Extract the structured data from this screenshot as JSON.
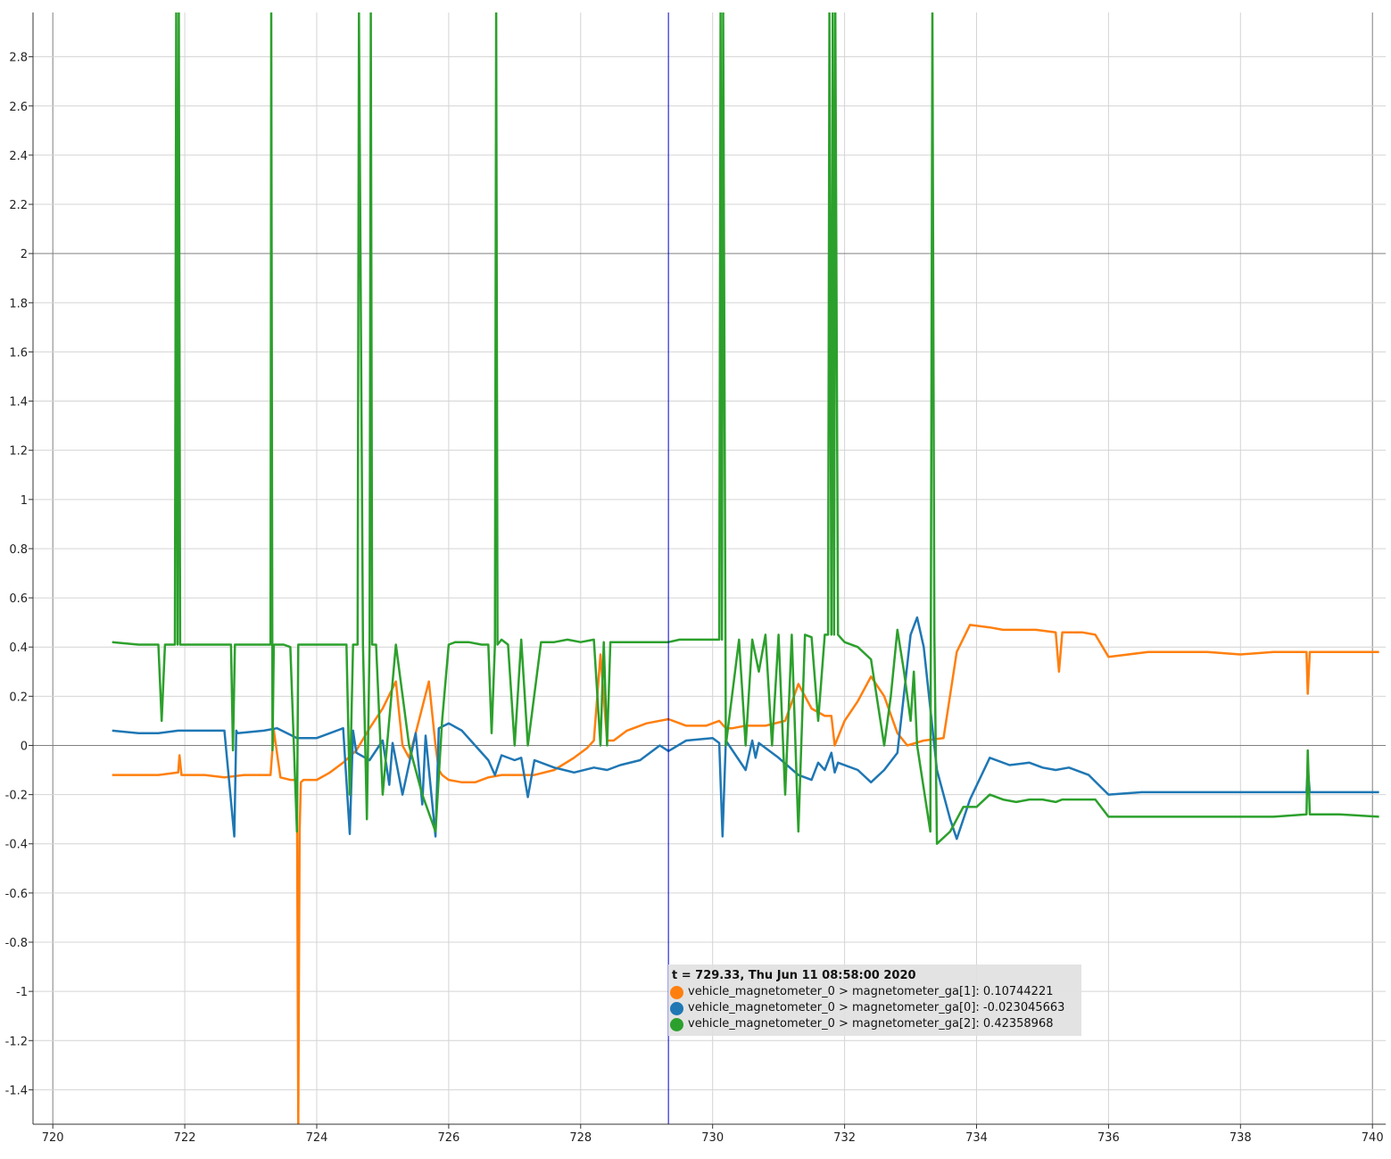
{
  "chart_data": {
    "type": "line",
    "xlim": [
      719.7,
      740.2
    ],
    "ylim": [
      -1.54,
      2.98
    ],
    "x_ticks": [
      720,
      722,
      724,
      726,
      728,
      730,
      732,
      734,
      736,
      738,
      740
    ],
    "y_ticks": [
      2.8,
      2.6,
      2.4,
      2.2,
      2,
      1.8,
      1.6,
      1.4,
      1.2,
      1,
      0.8,
      0.6,
      0.4,
      0.2,
      0,
      -0.2,
      -0.4,
      -0.6,
      -0.8,
      -1,
      -1.2,
      -1.4
    ],
    "x_tick_labels": [
      "720",
      "722",
      "724",
      "726",
      "728",
      "730",
      "732",
      "734",
      "736",
      "738",
      "740"
    ],
    "y_tick_labels": [
      "2.8",
      "2.6",
      "2.4",
      "2.2",
      "2",
      "1.8",
      "1.6",
      "1.4",
      "1.2",
      "1",
      "0.8",
      "0.6",
      "0.4",
      "0.2",
      "0",
      "-0.2",
      "-0.4",
      "-0.6",
      "-0.8",
      "-1",
      "-1.2",
      "-1.4"
    ],
    "grid": true,
    "cursor_x": 729.33,
    "series": [
      {
        "name": "vehicle_magnetometer_0 > magnetometer_ga[1]",
        "color": "#ff7f0e",
        "x": [
          720.9,
          721.3,
          721.6,
          721.9,
          721.92,
          721.95,
          722.3,
          722.6,
          722.9,
          723.2,
          723.3,
          723.35,
          723.45,
          723.6,
          723.7,
          723.72,
          723.74,
          723.76,
          723.8,
          724.0,
          724.2,
          724.4,
          724.6,
          724.8,
          725.0,
          725.2,
          725.3,
          725.4,
          725.5,
          725.7,
          725.8,
          725.85,
          725.9,
          726.0,
          726.2,
          726.4,
          726.6,
          726.8,
          727.0,
          727.3,
          727.6,
          727.9,
          728.1,
          728.2,
          728.3,
          728.4,
          728.5,
          728.7,
          729.0,
          729.33,
          729.6,
          729.9,
          730.1,
          730.2,
          730.3,
          730.5,
          730.8,
          731.1,
          731.3,
          731.5,
          731.7,
          731.8,
          731.85,
          732.0,
          732.2,
          732.4,
          732.6,
          732.8,
          732.95,
          733.2,
          733.5,
          733.7,
          733.9,
          734.2,
          734.4,
          734.6,
          734.9,
          735.2,
          735.25,
          735.3,
          735.6,
          735.8,
          736.0,
          736.3,
          736.6,
          737.0,
          737.5,
          738.0,
          738.5,
          739.0,
          739.02,
          739.05,
          739.5,
          740.1
        ],
        "values": [
          -0.12,
          -0.12,
          -0.12,
          -0.11,
          -0.04,
          -0.12,
          -0.12,
          -0.13,
          -0.12,
          -0.12,
          -0.12,
          0.06,
          -0.13,
          -0.14,
          -0.14,
          -1.54,
          -0.35,
          -0.15,
          -0.14,
          -0.14,
          -0.11,
          -0.07,
          -0.02,
          0.07,
          0.15,
          0.26,
          0.0,
          -0.05,
          0.05,
          0.26,
          0.0,
          -0.1,
          -0.12,
          -0.14,
          -0.15,
          -0.15,
          -0.13,
          -0.12,
          -0.12,
          -0.12,
          -0.1,
          -0.05,
          -0.01,
          0.02,
          0.37,
          0.02,
          0.02,
          0.06,
          0.09,
          0.107,
          0.08,
          0.08,
          0.1,
          0.07,
          0.07,
          0.08,
          0.08,
          0.1,
          0.25,
          0.15,
          0.12,
          0.12,
          0.0,
          0.1,
          0.18,
          0.28,
          0.2,
          0.05,
          0.0,
          0.02,
          0.03,
          0.38,
          0.49,
          0.48,
          0.47,
          0.47,
          0.47,
          0.46,
          0.3,
          0.46,
          0.46,
          0.45,
          0.36,
          0.37,
          0.38,
          0.38,
          0.38,
          0.37,
          0.38,
          0.38,
          0.21,
          0.38,
          0.38,
          0.38
        ]
      },
      {
        "name": "vehicle_magnetometer_0 > magnetometer_ga[0]",
        "color": "#1f77b4",
        "x": [
          720.9,
          721.3,
          721.6,
          721.9,
          722.2,
          722.6,
          722.75,
          722.78,
          722.8,
          723.2,
          723.4,
          723.7,
          724.0,
          724.4,
          724.5,
          724.55,
          724.6,
          724.8,
          725.0,
          725.1,
          725.15,
          725.3,
          725.5,
          725.6,
          725.65,
          725.8,
          725.85,
          726.0,
          726.2,
          726.4,
          726.6,
          726.7,
          726.8,
          727.0,
          727.1,
          727.2,
          727.3,
          727.6,
          727.9,
          728.2,
          728.4,
          728.6,
          728.9,
          729.2,
          729.33,
          729.6,
          730.0,
          730.1,
          730.15,
          730.2,
          730.5,
          730.6,
          730.65,
          730.7,
          731.0,
          731.3,
          731.5,
          731.6,
          731.7,
          731.8,
          731.85,
          731.9,
          732.2,
          732.4,
          732.6,
          732.8,
          733.0,
          733.1,
          733.2,
          733.4,
          733.6,
          733.7,
          733.9,
          734.2,
          734.5,
          734.8,
          735.0,
          735.2,
          735.4,
          735.7,
          736.0,
          736.5,
          737.0,
          737.5,
          738.0,
          738.5,
          739.0,
          739.02,
          739.05,
          739.5,
          740.1
        ],
        "values": [
          0.06,
          0.05,
          0.05,
          0.06,
          0.06,
          0.06,
          -0.37,
          0.06,
          0.05,
          0.06,
          0.07,
          0.03,
          0.03,
          0.07,
          -0.36,
          0.06,
          -0.03,
          -0.06,
          0.02,
          -0.16,
          0.01,
          -0.2,
          0.05,
          -0.24,
          0.04,
          -0.37,
          0.07,
          0.09,
          0.06,
          0.0,
          -0.06,
          -0.12,
          -0.04,
          -0.06,
          -0.05,
          -0.21,
          -0.06,
          -0.09,
          -0.11,
          -0.09,
          -0.1,
          -0.08,
          -0.06,
          0.0,
          -0.023,
          0.02,
          0.03,
          0.01,
          -0.37,
          0.02,
          -0.1,
          0.02,
          -0.05,
          0.01,
          -0.05,
          -0.12,
          -0.14,
          -0.07,
          -0.1,
          -0.03,
          -0.11,
          -0.07,
          -0.1,
          -0.15,
          -0.1,
          -0.03,
          0.45,
          0.52,
          0.4,
          -0.1,
          -0.3,
          -0.38,
          -0.22,
          -0.05,
          -0.08,
          -0.07,
          -0.09,
          -0.1,
          -0.09,
          -0.12,
          -0.2,
          -0.19,
          -0.19,
          -0.19,
          -0.19,
          -0.19,
          -0.19,
          -0.09,
          -0.19,
          -0.19,
          -0.19
        ]
      },
      {
        "name": "vehicle_magnetometer_0 > magnetometer_ga[2]",
        "color": "#2ca02c",
        "x": [
          720.9,
          721.3,
          721.6,
          721.65,
          721.7,
          721.85,
          721.87,
          721.89,
          721.91,
          721.93,
          721.96,
          722.3,
          722.6,
          722.7,
          722.73,
          722.76,
          722.8,
          723.2,
          723.3,
          723.31,
          723.33,
          723.35,
          723.5,
          723.6,
          723.7,
          723.72,
          723.74,
          724.0,
          724.2,
          724.45,
          724.5,
          724.55,
          724.62,
          724.64,
          724.7,
          724.76,
          724.8,
          724.82,
          724.84,
          724.9,
          725.0,
          725.2,
          725.4,
          725.6,
          725.8,
          725.9,
          726.0,
          726.1,
          726.3,
          726.5,
          726.6,
          726.65,
          726.7,
          726.72,
          726.74,
          726.8,
          726.9,
          727.0,
          727.1,
          727.2,
          727.4,
          727.6,
          727.8,
          728.0,
          728.2,
          728.3,
          728.35,
          728.4,
          728.45,
          728.6,
          728.65,
          728.9,
          729.0,
          729.33,
          729.5,
          729.8,
          730.0,
          730.1,
          730.12,
          730.14,
          730.16,
          730.2,
          730.4,
          730.5,
          730.6,
          730.7,
          730.8,
          730.9,
          731.0,
          731.1,
          731.2,
          731.3,
          731.4,
          731.5,
          731.6,
          731.7,
          731.75,
          731.77,
          731.8,
          731.82,
          731.84,
          731.86,
          731.9,
          732.0,
          732.2,
          732.4,
          732.6,
          732.7,
          732.8,
          732.9,
          733.0,
          733.05,
          733.1,
          733.3,
          733.33,
          733.36,
          733.4,
          733.6,
          733.8,
          734.0,
          734.2,
          734.4,
          734.6,
          734.8,
          735.0,
          735.2,
          735.3,
          735.6,
          735.8,
          736.0,
          736.5,
          737.0,
          737.5,
          738.0,
          738.5,
          739.0,
          739.02,
          739.05,
          739.5,
          740.1
        ],
        "values": [
          0.42,
          0.41,
          0.41,
          0.1,
          0.41,
          0.41,
          2.98,
          0.41,
          2.98,
          0.41,
          0.41,
          0.41,
          0.41,
          0.41,
          -0.02,
          0.41,
          0.41,
          0.41,
          0.41,
          2.98,
          -0.02,
          0.41,
          0.41,
          0.4,
          -0.35,
          0.41,
          0.41,
          0.41,
          0.41,
          0.41,
          -0.2,
          0.41,
          0.41,
          2.98,
          0.41,
          -0.3,
          0.41,
          2.98,
          0.41,
          0.41,
          -0.2,
          0.41,
          0.0,
          -0.2,
          -0.35,
          0.1,
          0.41,
          0.42,
          0.42,
          0.41,
          0.41,
          0.05,
          0.41,
          2.98,
          0.41,
          0.43,
          0.41,
          0.0,
          0.43,
          0.0,
          0.42,
          0.42,
          0.43,
          0.42,
          0.43,
          0.0,
          0.42,
          0.0,
          0.42,
          0.42,
          0.42,
          0.42,
          0.42,
          0.42,
          0.43,
          0.43,
          0.43,
          0.43,
          2.98,
          0.43,
          2.98,
          0.0,
          0.43,
          0.0,
          0.43,
          0.3,
          0.45,
          0.0,
          0.45,
          -0.2,
          0.45,
          -0.35,
          0.45,
          0.44,
          0.1,
          0.45,
          0.45,
          2.98,
          0.45,
          2.98,
          0.45,
          2.98,
          0.45,
          0.42,
          0.4,
          0.35,
          0.0,
          0.2,
          0.47,
          0.3,
          0.1,
          0.3,
          0.0,
          -0.35,
          2.98,
          0.45,
          -0.4,
          -0.35,
          -0.25,
          -0.25,
          -0.2,
          -0.22,
          -0.23,
          -0.22,
          -0.22,
          -0.23,
          -0.22,
          -0.22,
          -0.22,
          -0.29,
          -0.29,
          -0.29,
          -0.29,
          -0.29,
          -0.29,
          -0.28,
          -0.02,
          -0.28,
          -0.28,
          -0.29
        ]
      }
    ]
  },
  "tooltip": {
    "title": "t = 729.33, Thu Jun 11 08:58:00 2020",
    "rows": [
      {
        "text": "vehicle_magnetometer_0 > magnetometer_ga[1]: 0.10744221",
        "color": "#ff7f0e"
      },
      {
        "text": "vehicle_magnetometer_0 > magnetometer_ga[0]: -0.023045663",
        "color": "#1f77b4"
      },
      {
        "text": "vehicle_magnetometer_0 > magnetometer_ga[2]: 0.42358968",
        "color": "#2ca02c"
      }
    ]
  },
  "colors": {
    "grid": "#d4d4d4",
    "major_grid": "#7f7f7f",
    "cursor": "#0000cc"
  }
}
